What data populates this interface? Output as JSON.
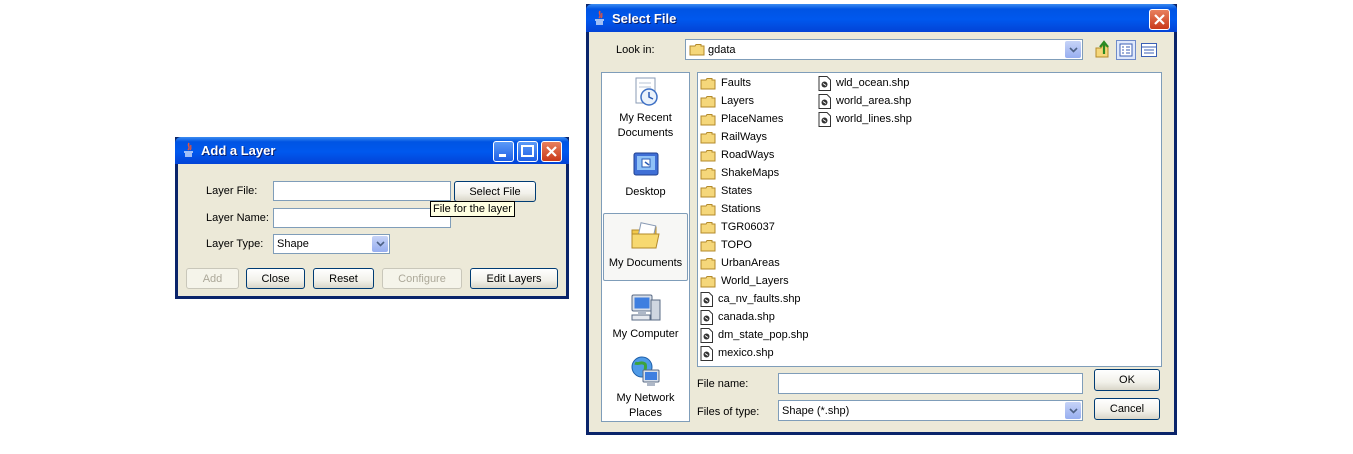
{
  "add_layer": {
    "title": "Add a Layer",
    "layer_file_label": "Layer File:",
    "layer_file_value": "",
    "layer_name_label": "Layer Name:",
    "layer_name_value": "",
    "layer_type_label": "Layer Type:",
    "layer_type_value": "Shape",
    "select_file_button": "Select File",
    "tooltip": "File for the layer",
    "buttons": {
      "add": "Add",
      "close": "Close",
      "reset": "Reset",
      "configure": "Configure",
      "edit_layers": "Edit Layers"
    }
  },
  "select_file": {
    "title": "Select File",
    "look_in_label": "Look in:",
    "look_in_value": "gdata",
    "places": [
      {
        "label": "My Recent Documents",
        "icon": "recent-documents-icon"
      },
      {
        "label": "Desktop",
        "icon": "desktop-icon"
      },
      {
        "label": "My Documents",
        "icon": "my-documents-icon"
      },
      {
        "label": "My Computer",
        "icon": "my-computer-icon"
      },
      {
        "label": "My Network Places",
        "icon": "network-places-icon"
      }
    ],
    "files_col1": [
      {
        "name": "Faults",
        "type": "folder"
      },
      {
        "name": "Layers",
        "type": "folder"
      },
      {
        "name": "PlaceNames",
        "type": "folder"
      },
      {
        "name": "RailWays",
        "type": "folder"
      },
      {
        "name": "RoadWays",
        "type": "folder"
      },
      {
        "name": "ShakeMaps",
        "type": "folder"
      },
      {
        "name": "States",
        "type": "folder"
      },
      {
        "name": "Stations",
        "type": "folder"
      },
      {
        "name": "TGR06037",
        "type": "folder"
      },
      {
        "name": "TOPO",
        "type": "folder"
      },
      {
        "name": "UrbanAreas",
        "type": "folder"
      },
      {
        "name": "World_Layers",
        "type": "folder"
      },
      {
        "name": "ca_nv_faults.shp",
        "type": "file"
      },
      {
        "name": "canada.shp",
        "type": "file"
      },
      {
        "name": "dm_state_pop.shp",
        "type": "file"
      },
      {
        "name": "mexico.shp",
        "type": "file"
      }
    ],
    "files_col2": [
      {
        "name": "wld_ocean.shp",
        "type": "file"
      },
      {
        "name": "world_area.shp",
        "type": "file"
      },
      {
        "name": "world_lines.shp",
        "type": "file"
      }
    ],
    "file_name_label": "File name:",
    "file_name_value": "",
    "files_of_type_label": "Files of type:",
    "files_of_type_value": "Shape (*.shp)",
    "ok_button": "OK",
    "cancel_button": "Cancel"
  }
}
